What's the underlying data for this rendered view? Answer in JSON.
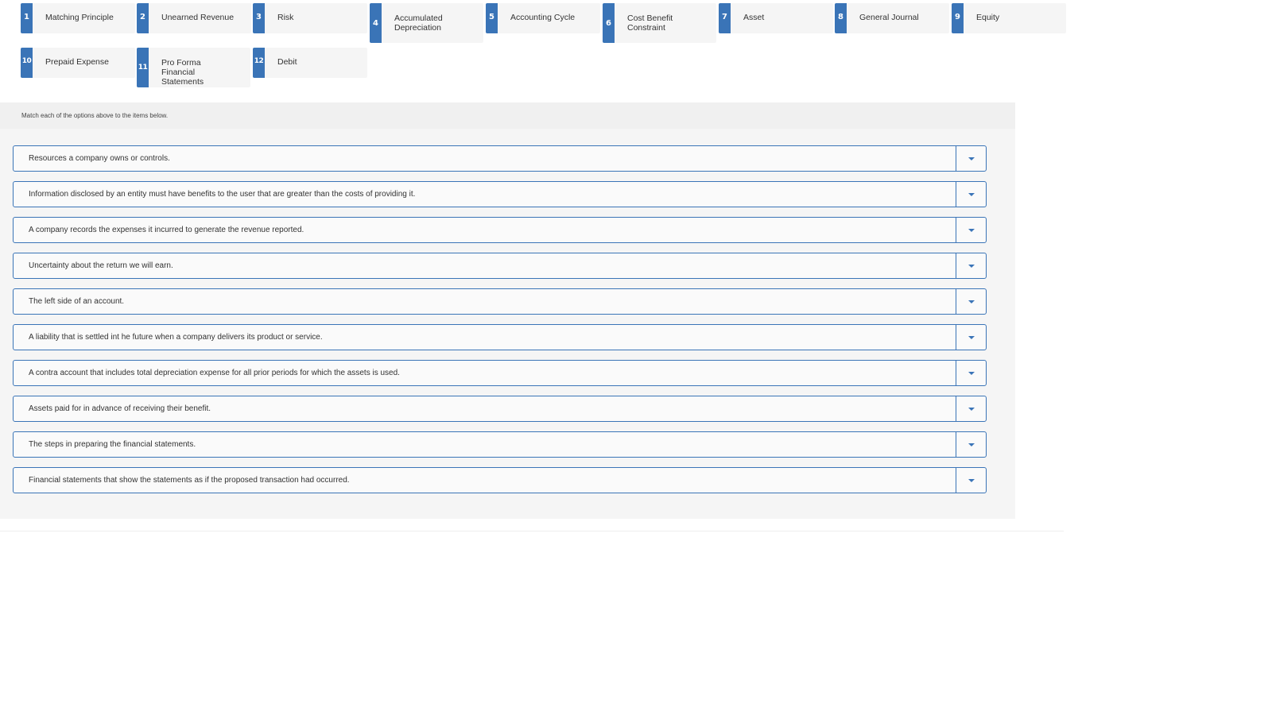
{
  "options": [
    {
      "number": "1",
      "label": "Matching Principle"
    },
    {
      "number": "2",
      "label": "Unearned Revenue"
    },
    {
      "number": "3",
      "label": "Risk"
    },
    {
      "number": "4",
      "label": "Accumulated Depreciation"
    },
    {
      "number": "5",
      "label": "Accounting Cycle"
    },
    {
      "number": "6",
      "label": "Cost Benefit Constraint"
    },
    {
      "number": "7",
      "label": "Asset"
    },
    {
      "number": "8",
      "label": "General Journal"
    },
    {
      "number": "9",
      "label": "Equity"
    },
    {
      "number": "10",
      "label": "Prepaid Expense"
    },
    {
      "number": "11",
      "label": "Pro Forma Financial Statements"
    },
    {
      "number": "12",
      "label": "Debit"
    }
  ],
  "instructions": "Match each of the options above to the items below.",
  "items": [
    {
      "text": "Resources a company owns or controls.",
      "selected": ""
    },
    {
      "text": "Information disclosed by an entity must have benefits to the user that are greater than the costs of providing it.",
      "selected": ""
    },
    {
      "text": "A company records the expenses it incurred to generate the revenue reported.",
      "selected": ""
    },
    {
      "text": "Uncertainty about the return we will earn.",
      "selected": ""
    },
    {
      "text": "The left side of an account.",
      "selected": ""
    },
    {
      "text": "A liability that is settled int he future when a company delivers its product or service.",
      "selected": ""
    },
    {
      "text": "A contra account that includes total depreciation expense for all prior periods for which the assets is used.",
      "selected": ""
    },
    {
      "text": "Assets paid for in advance of receiving their benefit.",
      "selected": ""
    },
    {
      "text": "The steps in preparing the financial statements.",
      "selected": ""
    },
    {
      "text": "Financial statements that show the statements as if the proposed transaction had occurred.",
      "selected": ""
    }
  ],
  "colors": {
    "accent": "#3a74b7",
    "tile_bg": "#f5f5f5",
    "panel_bg": "#f5f5f5",
    "panel_head_bg": "#f0f0f0"
  }
}
